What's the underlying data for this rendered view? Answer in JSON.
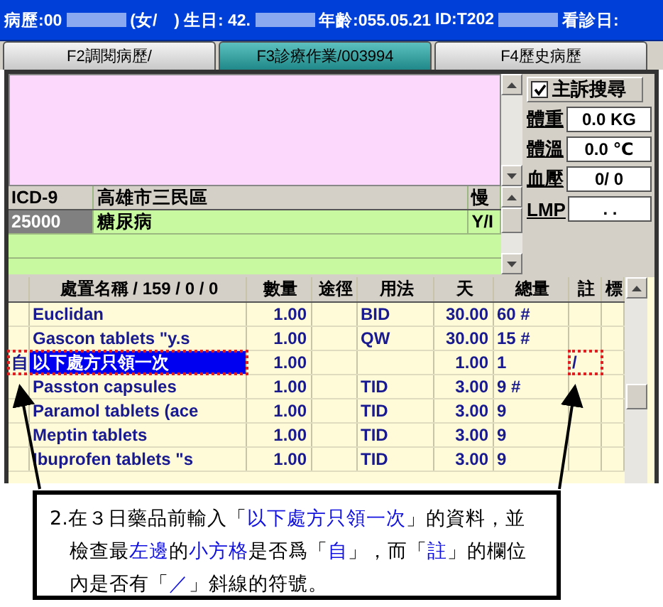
{
  "header": [
    {
      "kind": "text",
      "text": "病歷:00"
    },
    {
      "kind": "redacted"
    },
    {
      "kind": "text",
      "text": "(女/　)"
    },
    {
      "kind": "text",
      "text": "生日: 42."
    },
    {
      "kind": "redacted"
    },
    {
      "kind": "text",
      "text": "年齡:055.05.21"
    },
    {
      "kind": "text",
      "text": "ID:T202"
    },
    {
      "kind": "redacted"
    },
    {
      "kind": "text",
      "text": "看診日:"
    }
  ],
  "tabs": [
    {
      "label": "F2調閱病歷/",
      "selected": false
    },
    {
      "label": "F3診療作業/003994",
      "selected": true
    },
    {
      "label": "F4歷史病歷",
      "selected": false
    }
  ],
  "side_panel": {
    "search": {
      "label": "主訴搜尋",
      "checked": true
    },
    "fields": [
      {
        "label": "體重",
        "value": "0.0 KG"
      },
      {
        "label": "體溫",
        "value": "0.0 ℃"
      },
      {
        "label": "血壓",
        "value": "0/ 0"
      },
      {
        "label": "LMP",
        "value": ". ."
      }
    ]
  },
  "diagnosis": {
    "columns": [
      "ICD-9",
      "高雄市三民區",
      "慢"
    ],
    "rows": [
      {
        "code": "25000",
        "name": "糖尿病",
        "column_3": "Y/I"
      }
    ]
  },
  "orders": {
    "columns": [
      "",
      "處置名稱 / 159 / 0 / 0",
      "數量",
      "途徑",
      "用法",
      "天",
      "總量",
      "註",
      "標"
    ],
    "rows": [
      {
        "mark": "",
        "name": "Euclidan",
        "qty": "1.00",
        "route": "",
        "usage": "BID",
        "days": "30.00",
        "total": "60 #",
        "note": "",
        "selected": false,
        "flagged": false
      },
      {
        "mark": "",
        "name": "Gascon tablets \"y.s",
        "qty": "1.00",
        "route": "",
        "usage": "QW",
        "days": "30.00",
        "total": "15 #",
        "note": "",
        "selected": false,
        "flagged": false
      },
      {
        "mark": "自",
        "name": "以下處方只領一次",
        "qty": "1.00",
        "route": "",
        "usage": "",
        "days": "1.00",
        "total": "1",
        "note": "/",
        "selected": true,
        "flagged": true
      },
      {
        "mark": "",
        "name": "Passton capsules",
        "qty": "1.00",
        "route": "",
        "usage": "TID",
        "days": "3.00",
        "total": "9 #",
        "note": "",
        "selected": false,
        "flagged": false
      },
      {
        "mark": "",
        "name": "Paramol tablets (ace",
        "qty": "1.00",
        "route": "",
        "usage": "TID",
        "days": "3.00",
        "total": "9",
        "note": "",
        "selected": false,
        "flagged": false
      },
      {
        "mark": "",
        "name": "Meptin tablets",
        "qty": "1.00",
        "route": "",
        "usage": "TID",
        "days": "3.00",
        "total": "9",
        "note": "",
        "selected": false,
        "flagged": false
      },
      {
        "mark": "",
        "name": "Ibuprofen tablets \"s",
        "qty": "1.00",
        "route": "",
        "usage": "TID",
        "days": "3.00",
        "total": "9",
        "note": "",
        "selected": false,
        "flagged": false
      }
    ]
  },
  "callout": {
    "segments": [
      {
        "text": "2.在３日藥品前輸入「",
        "highlight": false
      },
      {
        "text": "以下處方只領一次",
        "highlight": true
      },
      {
        "text": "」的資料，並檢查最",
        "highlight": false
      },
      {
        "text": "左邊",
        "highlight": true
      },
      {
        "text": "的",
        "highlight": false
      },
      {
        "text": "小方格",
        "highlight": true
      },
      {
        "text": "是否爲「",
        "highlight": false
      },
      {
        "text": "自",
        "highlight": true
      },
      {
        "text": "」，而「",
        "highlight": false
      },
      {
        "text": "註",
        "highlight": true
      },
      {
        "text": "」的欄位內是否有「",
        "highlight": false
      },
      {
        "text": "／",
        "highlight": true
      },
      {
        "text": "」斜線的符號。",
        "highlight": false
      }
    ]
  }
}
